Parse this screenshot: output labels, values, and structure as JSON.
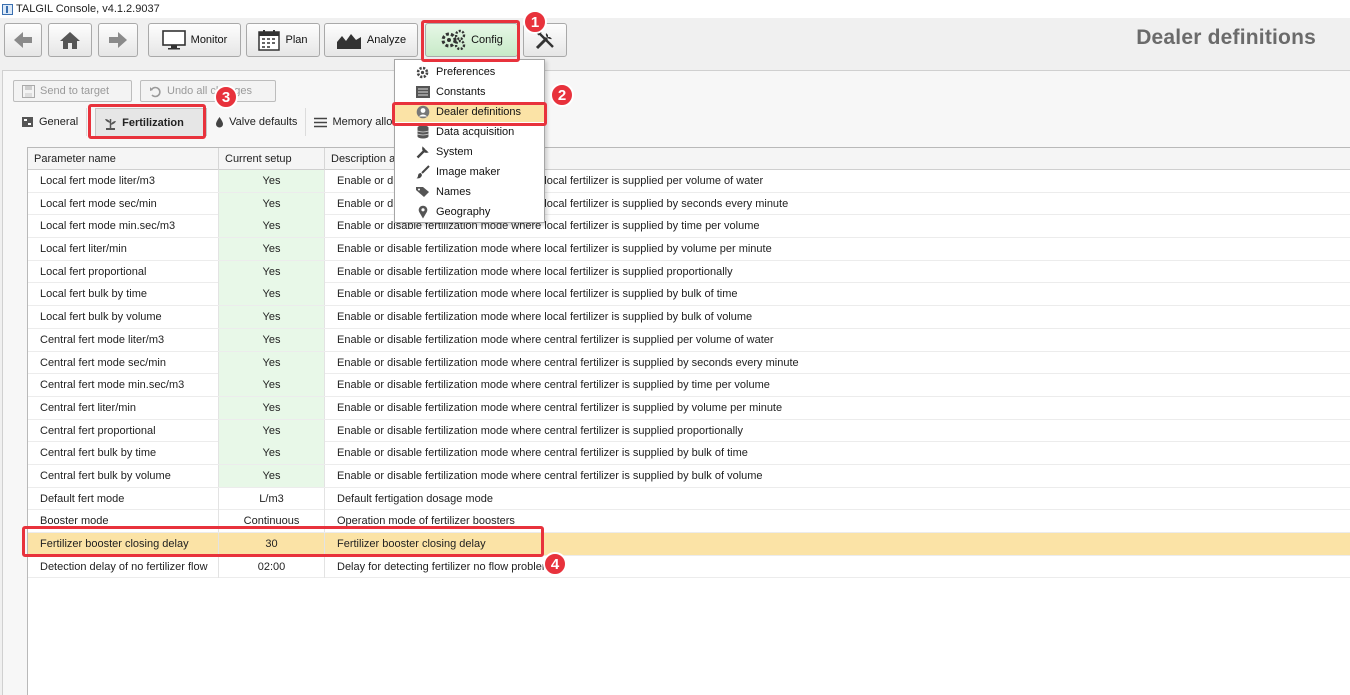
{
  "window": {
    "title": "TALGIL Console, v4.1.2.9037"
  },
  "toolbar": {
    "monitor_label": "Monitor",
    "plan_label": "Plan",
    "analyze_label": "Analyze",
    "config_label": "Config",
    "page_heading": "Dealer definitions"
  },
  "actions": {
    "send_label": "Send to target",
    "undo_label": "Undo all changes"
  },
  "tabs": [
    {
      "label": "General"
    },
    {
      "label": "Fertilization"
    },
    {
      "label": "Valve defaults"
    },
    {
      "label": "Memory allocation"
    }
  ],
  "config_menu": {
    "items": [
      {
        "label": "Preferences",
        "icon": "gear-icon"
      },
      {
        "label": "Constants",
        "icon": "list-icon"
      },
      {
        "label": "Dealer definitions",
        "icon": "user-icon"
      },
      {
        "label": "Data acquisition",
        "icon": "database-icon"
      },
      {
        "label": "System",
        "icon": "wrench-icon"
      },
      {
        "label": "Image maker",
        "icon": "brush-icon"
      },
      {
        "label": "Names",
        "icon": "tag-icon"
      },
      {
        "label": "Geography",
        "icon": "pin-icon"
      }
    ]
  },
  "table": {
    "headers": {
      "name": "Parameter name",
      "setup": "Current setup",
      "desc": "Description a"
    },
    "rows": [
      {
        "name": "Local fert mode liter/m3",
        "value": "Yes",
        "desc": "Enable or disable fertilization mode where local fertilizer is supplied per volume of water"
      },
      {
        "name": "Local fert mode sec/min",
        "value": "Yes",
        "desc": "Enable or disable fertilization mode where local fertilizer is supplied by seconds every minute"
      },
      {
        "name": "Local fert mode min.sec/m3",
        "value": "Yes",
        "desc": "Enable or disable fertilization mode where local fertilizer is supplied by time per volume"
      },
      {
        "name": "Local fert liter/min",
        "value": "Yes",
        "desc": "Enable or disable fertilization mode where local fertilizer is supplied by volume per minute"
      },
      {
        "name": "Local fert proportional",
        "value": "Yes",
        "desc": "Enable or disable fertilization mode where local fertilizer is supplied proportionally"
      },
      {
        "name": "Local fert bulk by time",
        "value": "Yes",
        "desc": "Enable or disable fertilization mode where local fertilizer is supplied by bulk of time"
      },
      {
        "name": "Local fert bulk by volume",
        "value": "Yes",
        "desc": "Enable or disable fertilization mode where local fertilizer is supplied by bulk of volume"
      },
      {
        "name": "Central fert mode liter/m3",
        "value": "Yes",
        "desc": "Enable or disable fertilization mode where central fertilizer is supplied per volume of water"
      },
      {
        "name": "Central fert mode sec/min",
        "value": "Yes",
        "desc": "Enable or disable fertilization mode where central fertilizer is supplied by seconds every minute"
      },
      {
        "name": "Central fert mode min.sec/m3",
        "value": "Yes",
        "desc": "Enable or disable fertilization mode where central fertilizer is supplied by time per volume"
      },
      {
        "name": "Central fert liter/min",
        "value": "Yes",
        "desc": "Enable or disable fertilization mode where central fertilizer is supplied by volume per minute"
      },
      {
        "name": "Central fert proportional",
        "value": "Yes",
        "desc": "Enable or disable fertilization mode where central fertilizer is supplied proportionally"
      },
      {
        "name": "Central fert bulk by time",
        "value": "Yes",
        "desc": "Enable or disable fertilization mode where central fertilizer is supplied by bulk of time"
      },
      {
        "name": "Central fert bulk by volume",
        "value": "Yes",
        "desc": "Enable or disable fertilization mode where central fertilizer is supplied by bulk of volume"
      },
      {
        "name": "Default fert mode",
        "value": "L/m3",
        "desc": "Default fertigation dosage mode"
      },
      {
        "name": "Booster mode",
        "value": "Continuous",
        "desc": "Operation mode of fertilizer boosters"
      },
      {
        "name": "Fertilizer booster closing delay",
        "value": "30",
        "desc": "Fertilizer booster closing delay"
      },
      {
        "name": "Detection delay of no fertilizer flow",
        "value": "02:00",
        "desc": "Delay for detecting fertilizer no flow problem"
      }
    ]
  },
  "annotations": {
    "step1": "1",
    "step2": "2",
    "step3": "3",
    "step4": "4"
  },
  "colors": {
    "highlight_red": "#e8323c",
    "selected_row": "#fbe3a6",
    "yes_cell": "#e8f8e8"
  }
}
